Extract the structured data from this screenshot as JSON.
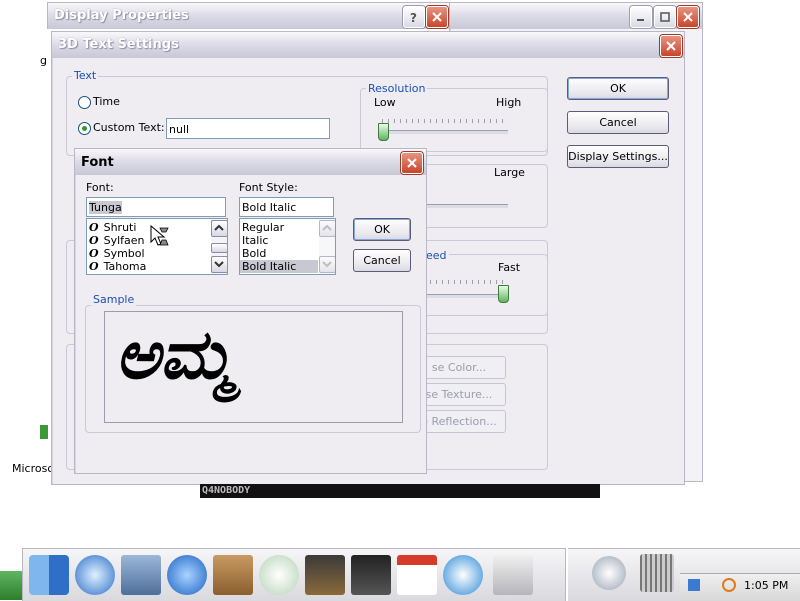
{
  "desktop": {
    "label_microsoft": "Microso",
    "label_g": "g",
    "watermark": "Q4NOBODY"
  },
  "display_properties": {
    "title": "Display Properties"
  },
  "text_settings": {
    "title": "3D Text Settings",
    "text_group": "Text",
    "time_label": "Time",
    "custom_text_label": "Custom Text:",
    "custom_text_value": "null",
    "resolution_group": "Resolution",
    "low_label": "Low",
    "high_label": "High",
    "large_label": "Large",
    "speed_group_fragment": "eed",
    "fast_label": "Fast",
    "ok_label": "OK",
    "cancel_label": "Cancel",
    "display_settings_label": "Display Settings...",
    "choose_color_fragment": "se Color...",
    "choose_texture_fragment": "se Texture...",
    "reflection_fragment": "e Reflection...",
    "resolution_level": 0.0,
    "speed_level": 1.0
  },
  "font_dialog": {
    "title": "Font",
    "font_label": "Font:",
    "font_value": "Tunga",
    "fonts": [
      "Shruti",
      "Sylfaen",
      "Symbol",
      "Tahoma"
    ],
    "style_label": "Font Style:",
    "style_value": "Bold Italic",
    "styles": [
      "Regular",
      "Italic",
      "Bold",
      "Bold Italic"
    ],
    "ok_label": "OK",
    "cancel_label": "Cancel",
    "sample_label": "Sample",
    "sample_text": "ಅಮ್ಮ"
  },
  "taskbar": {
    "clock": "1:05 PM"
  },
  "colors": {
    "accent_blue": "#1c4fb3",
    "close_red": "#c8452a",
    "slider_green": "#5fb65f"
  }
}
